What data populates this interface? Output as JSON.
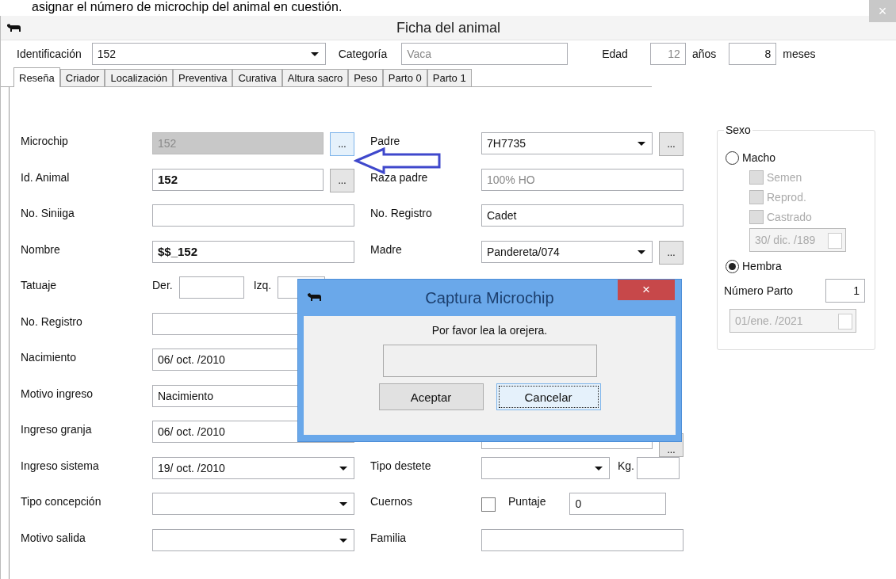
{
  "document_text": "asignar el número de microchip del animal en cuestión.",
  "window": {
    "title": "Ficha del animal",
    "close": "×"
  },
  "header": [
    {
      "kind": "combo",
      "label": "Identificación",
      "value": "152"
    },
    {
      "kind": "text",
      "label": "Categoría",
      "value": "Vaca",
      "disabled": true
    },
    {
      "kind": "age",
      "label": "Edad",
      "years": "12",
      "years_unit": "años",
      "months": "8",
      "months_unit": "meses"
    }
  ],
  "tabs": [
    {
      "label": "Reseña",
      "selected": true
    },
    {
      "label": "Criador",
      "selected": false
    },
    {
      "label": "Localización",
      "selected": false
    },
    {
      "label": "Preventiva",
      "selected": false
    },
    {
      "label": "Curativa",
      "selected": false
    },
    {
      "label": "Altura sacro",
      "selected": false
    },
    {
      "label": "Peso",
      "selected": false
    },
    {
      "label": "Parto 0",
      "selected": false
    },
    {
      "label": "Parto 1",
      "selected": false
    }
  ],
  "left_rows": [
    {
      "kind": "text",
      "label": "Microchip",
      "value": "152",
      "disabled": true,
      "bold": false,
      "button": "..."
    },
    {
      "kind": "text",
      "label": "Id. Animal",
      "value": "152",
      "disabled": false,
      "bold": true,
      "button": "..."
    },
    {
      "kind": "text",
      "label": "No. Siniiga"
    },
    {
      "kind": "text",
      "label": "Nombre",
      "value": "$$_152",
      "disabled": false,
      "bold": true
    },
    {
      "kind": "tatuaje",
      "label": "Tatuaje",
      "parts": [
        "Der.",
        "Izq."
      ]
    },
    {
      "kind": "text",
      "label": "No. Registro"
    },
    {
      "kind": "text",
      "label": "Nacimiento",
      "value": "06/ oct. /2010"
    },
    {
      "kind": "text",
      "label": "Motivo ingreso",
      "value": "Nacimiento"
    },
    {
      "kind": "text",
      "label": "Ingreso granja",
      "value": "06/ oct. /2010"
    },
    {
      "kind": "combo",
      "label": "Ingreso sistema",
      "value": "19/ oct. /2010"
    },
    {
      "kind": "combo",
      "label": "Tipo concepción"
    },
    {
      "kind": "combo",
      "label": "Motivo salida"
    }
  ],
  "middle_rows": [
    {
      "kind": "combo",
      "label": "Padre",
      "value": "7H7735",
      "button": "..."
    },
    {
      "kind": "text",
      "label": "Raza padre",
      "value": "100% HO",
      "disabled": true,
      "bold": false
    },
    {
      "kind": "text",
      "label": "No. Registro",
      "value": "Cadet",
      "disabled": false,
      "bold": false
    },
    {
      "kind": "combo",
      "label": "Madre",
      "value": "Pandereta/074",
      "button": "..."
    },
    {
      "kind": "covered"
    },
    {
      "kind": "covered"
    },
    {
      "kind": "covered"
    },
    {
      "kind": "covered"
    },
    {
      "kind": "text",
      "button": "..."
    },
    {
      "kind": "combo_unit",
      "label": "Tipo destete",
      "unit": "Kg."
    },
    {
      "kind": "check_score",
      "label": "Cuernos",
      "checked": false,
      "score_label": "Puntaje",
      "value": "0"
    },
    {
      "kind": "text",
      "label": "Familia"
    }
  ],
  "sexo": {
    "title": "Sexo",
    "macho": {
      "label": "Macho",
      "selected": false,
      "options": [
        {
          "label": "Semen",
          "checked": false
        },
        {
          "label": "Reprod.",
          "checked": false
        },
        {
          "label": "Castrado",
          "checked": false
        }
      ],
      "date": "30/ dic. /189"
    },
    "hembra": {
      "label": "Hembra",
      "selected": true
    },
    "numero_parto": {
      "label": "Número Parto",
      "value": "1"
    },
    "date": "01/ene. /2021"
  },
  "dialog": {
    "title": "Captura Microchip",
    "close": "×",
    "message": "Por favor lea la orejera.",
    "buttons": [
      {
        "label": "Aceptar",
        "focused": false
      },
      {
        "label": "Cancelar",
        "focused": true
      }
    ]
  }
}
